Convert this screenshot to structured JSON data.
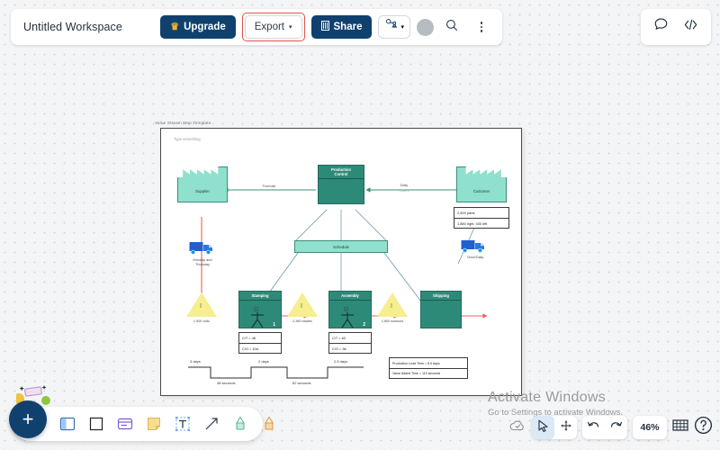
{
  "topbar": {
    "workspace_title": "Untitled Workspace",
    "upgrade_label": "Upgrade",
    "export_label": "Export",
    "share_label": "Share",
    "caret": "▾",
    "crown_icon": "♛"
  },
  "frame": {
    "label": "Value Stream Map Template",
    "placeholder": "Type something"
  },
  "diagram": {
    "title": "Value Stream Map",
    "supplier": "Supplier",
    "customer": "Customer",
    "production_control_line1": "Production",
    "production_control_line2": "Control",
    "schedule": "Schedule",
    "forecast_label": "Forecast",
    "daily_label": "Daily",
    "daily_sub": "orders",
    "supplier_ship_label_1": "Monday and",
    "supplier_ship_label_2": "Thursday",
    "customer_ship_label": "Once/Daily",
    "customer_data": [
      "2,500 parts",
      "1,880 right; 400 left"
    ],
    "processes": [
      {
        "name": "Stamping",
        "operators": "1",
        "data": [
          "C/T = 48",
          "C/O = 10U"
        ]
      },
      {
        "name": "Assembly",
        "operators": "2",
        "data": [
          "C/T = 62",
          "C/O = 36"
        ]
      },
      {
        "name": "Shipping",
        "operators": "",
        "data": []
      }
    ],
    "inventories": [
      {
        "mark": "I",
        "label": "1,500 coils"
      },
      {
        "mark": "I",
        "label": "2,380 blades"
      },
      {
        "mark": "I",
        "label": "1,800 scissors"
      }
    ],
    "timeline_lead": [
      "3 days",
      "2 days",
      "2.5 days"
    ],
    "timeline_value": [
      "48 seconds",
      "62 seconds"
    ],
    "summary": [
      "Production Lead Time = 8.5 days",
      "Value Added Time = 110 seconds"
    ]
  },
  "watermark": {
    "line1": "Activate Windows",
    "line2": "Go to Settings to activate Windows."
  },
  "bottom_toolbar": {
    "add_label": "+",
    "tools": [
      {
        "name": "template-icon"
      },
      {
        "name": "shape-square-icon"
      },
      {
        "name": "card-icon"
      },
      {
        "name": "sticky-note-icon"
      },
      {
        "name": "text-icon"
      },
      {
        "name": "arrow-icon"
      },
      {
        "name": "marker-icon"
      },
      {
        "name": "highlighter-icon"
      }
    ]
  },
  "bottom_right": {
    "zoom_level": "46%",
    "controls": [
      {
        "name": "cloud-sync-icon"
      },
      {
        "name": "cursor-select-icon"
      },
      {
        "name": "pan-move-icon"
      },
      {
        "name": "undo-icon"
      },
      {
        "name": "redo-icon"
      },
      {
        "name": "zoom-level"
      },
      {
        "name": "grid-icon"
      },
      {
        "name": "help-icon"
      }
    ]
  },
  "colors": {
    "brand_navy": "#10416e",
    "export_highlight": "#e0534f",
    "shape_light": "#8fe0cd",
    "shape_dark": "#2e8a78",
    "inventory_yellow": "#f6ee8f",
    "push_arrow": "#e8615c",
    "truck_blue": "#1f5fd0"
  }
}
